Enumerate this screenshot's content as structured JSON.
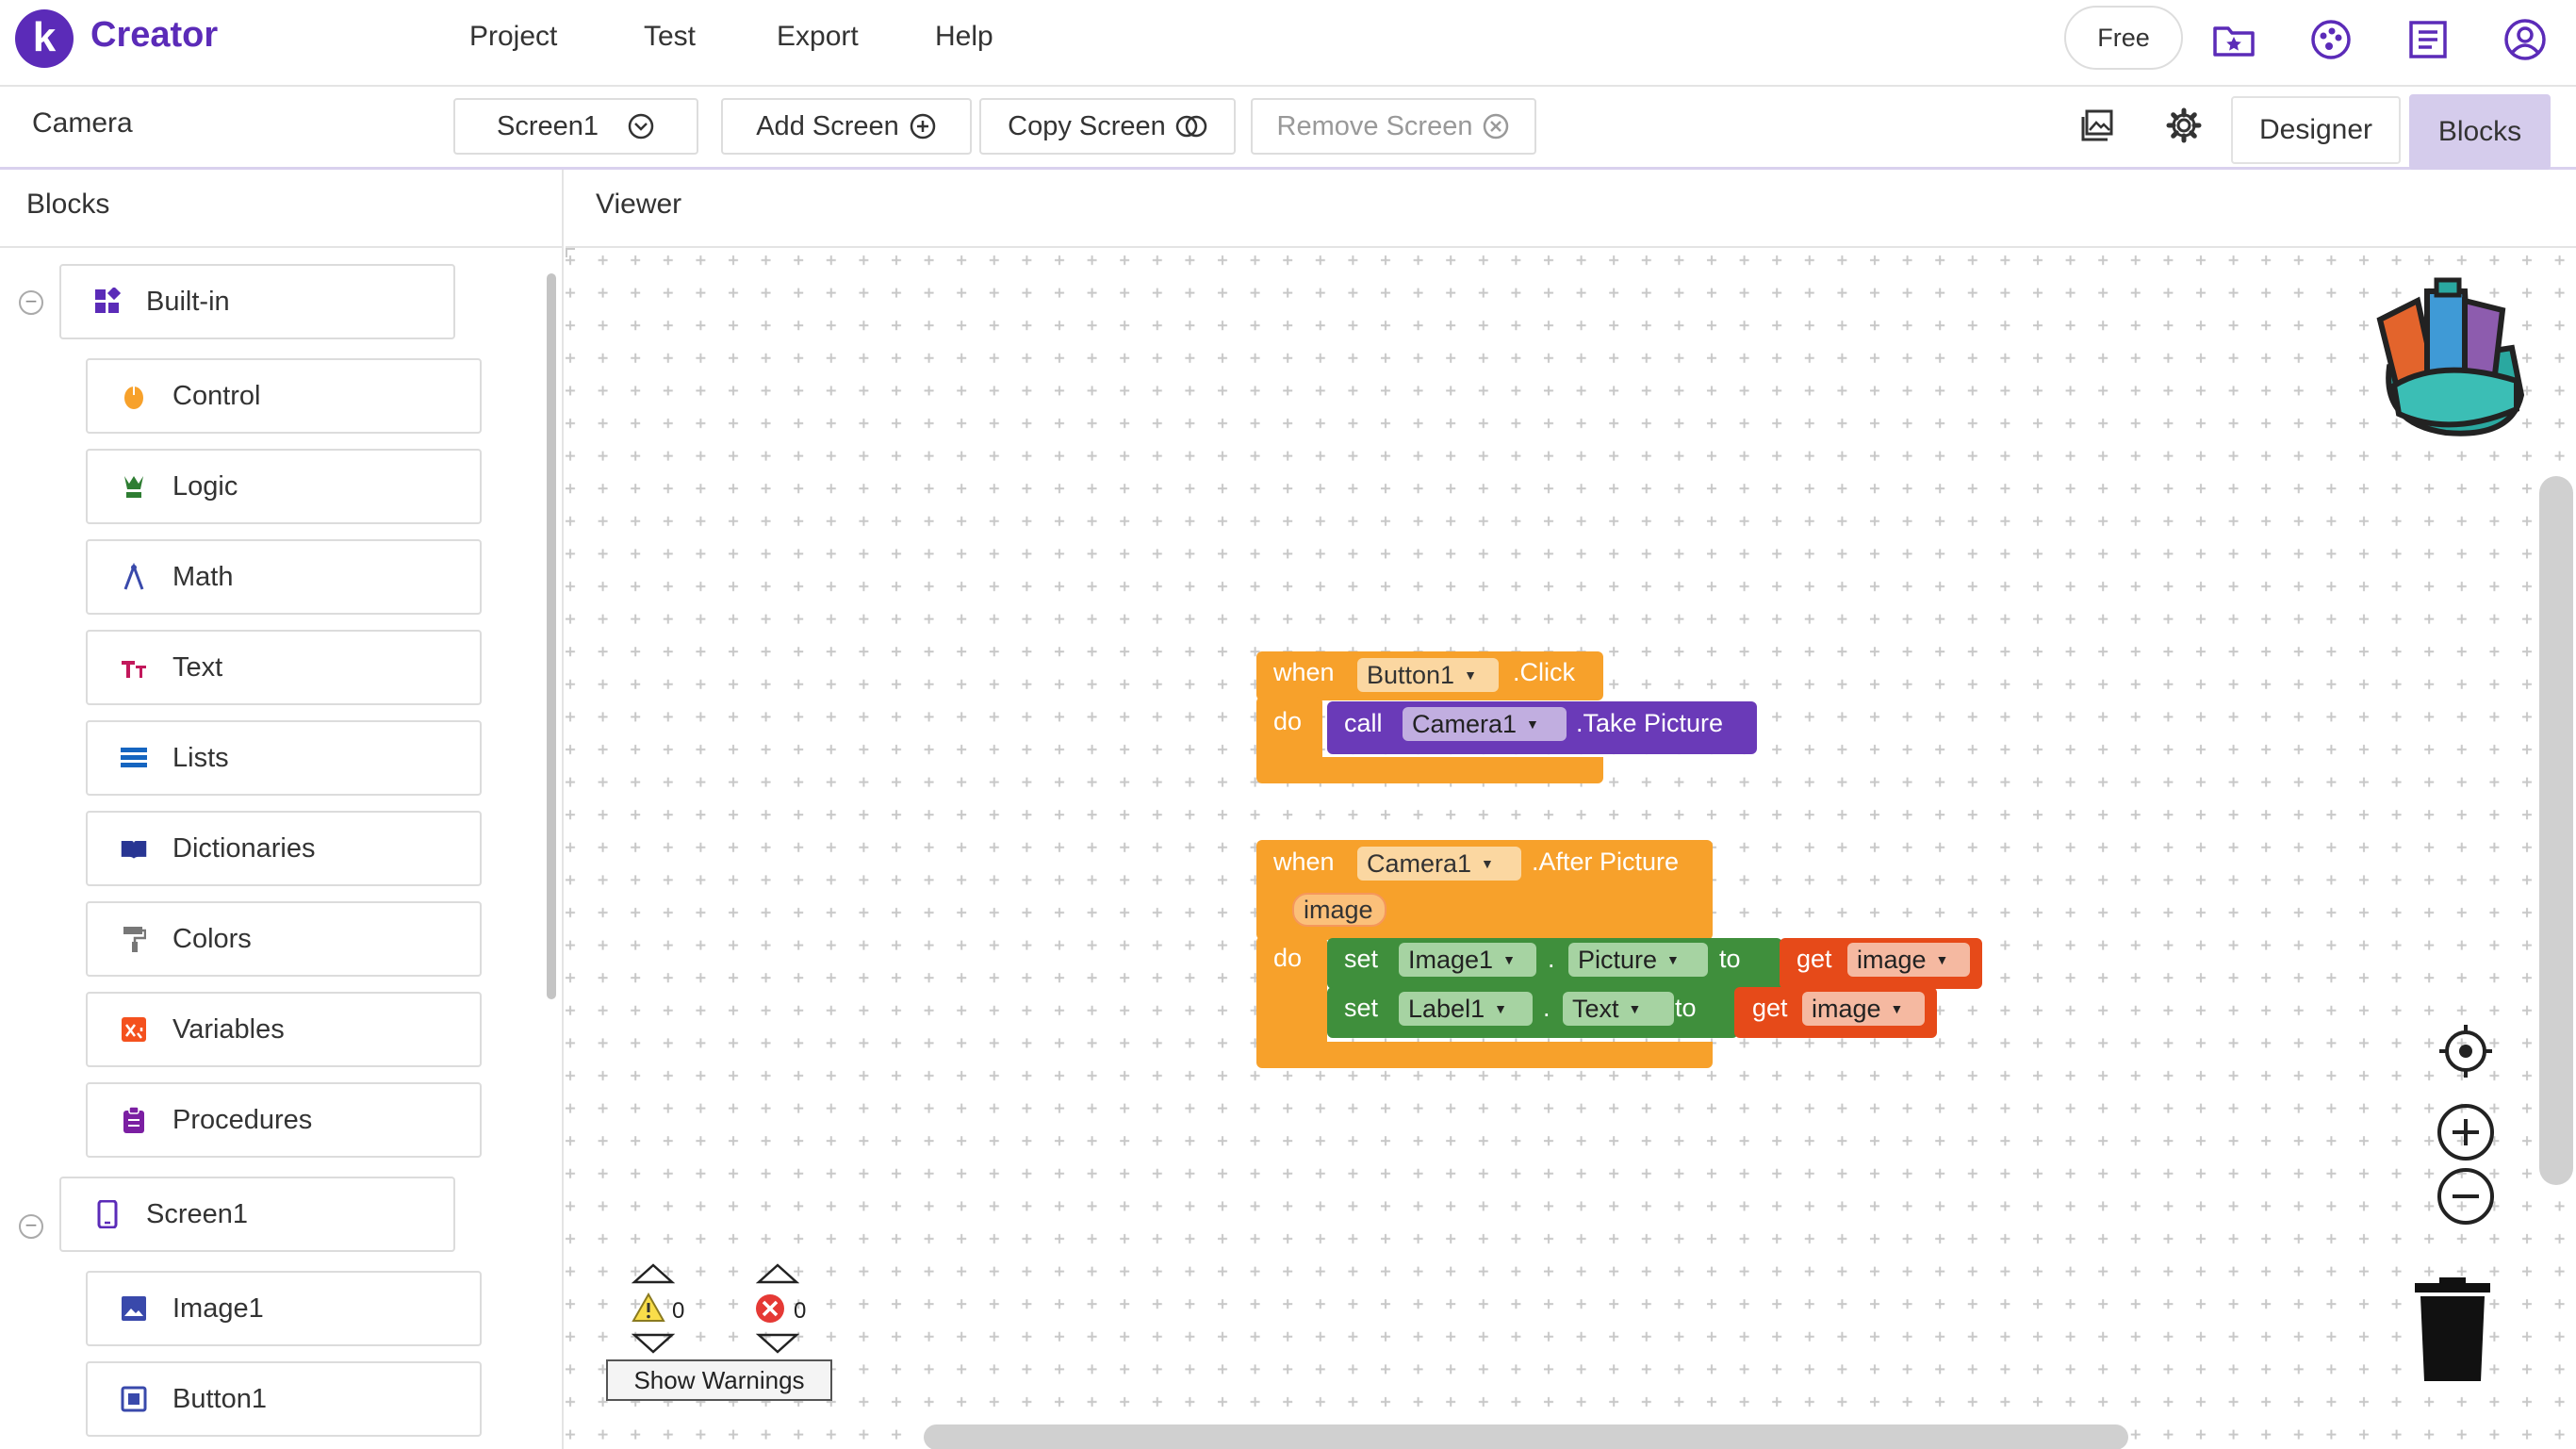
{
  "app": {
    "brand": "Creator",
    "logo_letter": "k"
  },
  "menu": {
    "items": [
      "Project",
      "Test",
      "Export",
      "Help"
    ]
  },
  "topbar": {
    "plan_label": "Free"
  },
  "screen_toolbar": {
    "project_name": "Camera",
    "screen_select": "Screen1",
    "add_screen": "Add Screen",
    "copy_screen": "Copy Screen",
    "remove_screen": "Remove Screen",
    "designer": "Designer",
    "blocks": "Blocks"
  },
  "blocks_panel": {
    "title": "Blocks",
    "builtin": "Built-in",
    "builtin_items": [
      "Control",
      "Logic",
      "Math",
      "Text",
      "Lists",
      "Dictionaries",
      "Colors",
      "Variables",
      "Procedures"
    ],
    "screen": "Screen1",
    "components": [
      "Image1",
      "Button1"
    ]
  },
  "viewer": {
    "title": "Viewer"
  },
  "block1": {
    "when": "when",
    "component": "Button1",
    "event": ".Click",
    "do": "do",
    "call": "call",
    "target": "Camera1",
    "method": ".Take Picture"
  },
  "block2": {
    "when": "when",
    "component": "Camera1",
    "event": ".After Picture",
    "param": "image",
    "do": "do",
    "set1": {
      "set": "set",
      "comp": "Image1",
      "dot": ".",
      "prop": "Picture",
      "to": "to",
      "get": "get",
      "var": "image"
    },
    "set2": {
      "set": "set",
      "comp": "Label1",
      "dot": ".",
      "prop": "Text",
      "to": "to",
      "get": "get",
      "var": "image"
    }
  },
  "warnings": {
    "warning_count": "0",
    "error_count": "0",
    "toggle_label": "Show Warnings"
  },
  "colors": {
    "brand": "#5b2bb8",
    "event_block": "#f7a12b",
    "procedure_block": "#6a3ab8",
    "setter_block": "#3f8f3c",
    "getter_block": "#e64a19",
    "active_tab": "#d5ccec"
  }
}
